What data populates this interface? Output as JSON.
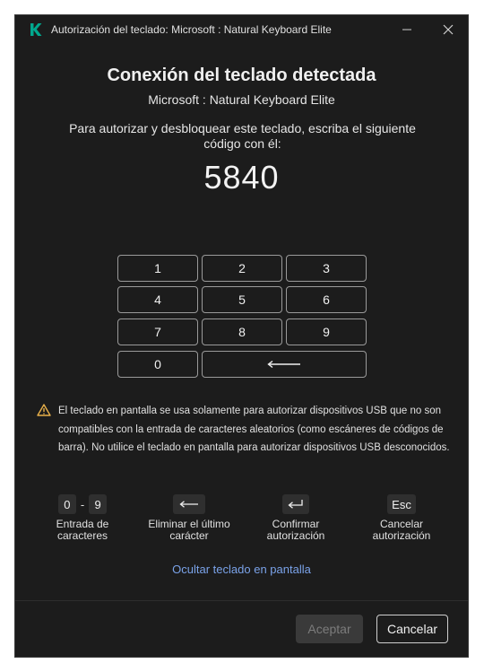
{
  "window": {
    "title": "Autorización del teclado: Microsoft : Natural Keyboard Elite"
  },
  "dialog": {
    "heading": "Conexión del teclado detectada",
    "device_name": "Microsoft : Natural Keyboard Elite",
    "instruction": "Para autorizar y desbloquear este teclado, escriba el siguiente código con él:",
    "code": "5840"
  },
  "keypad": {
    "keys": [
      "1",
      "2",
      "3",
      "4",
      "5",
      "6",
      "7",
      "8",
      "9",
      "0"
    ],
    "backspace_icon": "long-left-arrow-icon"
  },
  "warning": {
    "icon": "warning-triangle-icon",
    "text": "El teclado en pantalla se usa solamente para autorizar dispositivos USB que no son compatibles con la entrada de caracteres aleatorios (como escáneres de códigos de barra). No utilice el teclado en pantalla para autorizar dispositivos USB desconocidos."
  },
  "hints": [
    {
      "keys": [
        "0",
        "-",
        "9"
      ],
      "label": "Entrada de caracteres"
    },
    {
      "key_icon": "left-arrow-icon",
      "label": "Eliminar el último carácter"
    },
    {
      "key_icon": "enter-icon",
      "label": "Confirmar autorización"
    },
    {
      "keys": [
        "Esc"
      ],
      "label": "Cancelar autorización"
    }
  ],
  "hide_keyboard_link": "Ocultar teclado en pantalla",
  "footer": {
    "accept_label": "Aceptar",
    "cancel_label": "Cancelar"
  },
  "colors": {
    "background": "#1c1c1c",
    "logo": "#00a88e",
    "link": "#7aa2e8",
    "warning": "#e8b04a"
  }
}
